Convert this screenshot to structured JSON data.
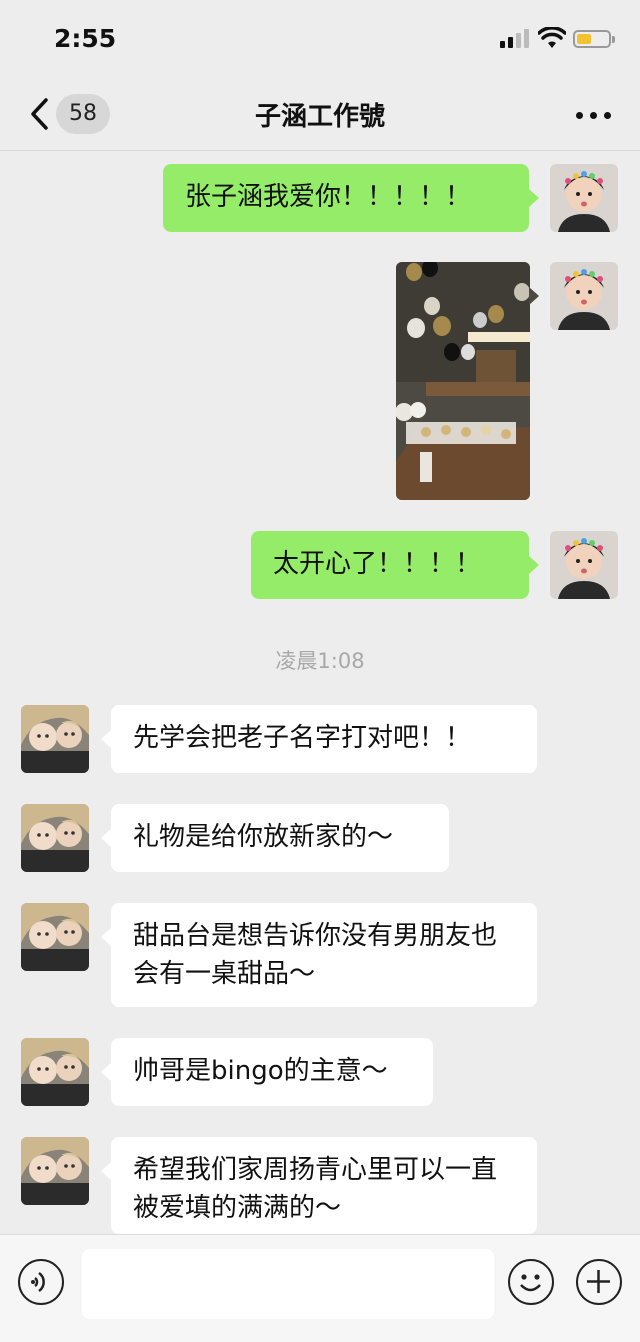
{
  "status_bar": {
    "time": "2:55",
    "battery_color": "#f2c230"
  },
  "nav": {
    "back_icon": "chevron-left-icon",
    "unread_count": "58",
    "title": "子涵工作號",
    "more_icon": "more-icon"
  },
  "colors": {
    "my_bubble": "#95ec69",
    "their_bubble": "#ffffff",
    "background": "#ededed"
  },
  "messages": [
    {
      "sender": "me",
      "type": "text",
      "text": "张子涵我爱你！！！！！"
    },
    {
      "sender": "me",
      "type": "image"
    },
    {
      "sender": "me",
      "type": "text",
      "text": "太开心了！！！！"
    },
    {
      "type": "timestamp",
      "text": "凌晨1:08"
    },
    {
      "sender": "other",
      "type": "text",
      "text": "先学会把老子名字打对吧！！"
    },
    {
      "sender": "other",
      "type": "text",
      "text": "礼物是给你放新家的～"
    },
    {
      "sender": "other",
      "type": "text",
      "text": "甜品台是想告诉你没有男朋友也会有一桌甜品～"
    },
    {
      "sender": "other",
      "type": "text",
      "text": "帅哥是bingo的主意～"
    },
    {
      "sender": "other",
      "type": "text",
      "text": "希望我们家周扬青心里可以一直被爱填的满满的～"
    }
  ],
  "input_bar": {
    "voice_icon": "voice-icon",
    "message_value": "",
    "emoji_icon": "emoji-icon",
    "plus_icon": "plus-icon"
  }
}
